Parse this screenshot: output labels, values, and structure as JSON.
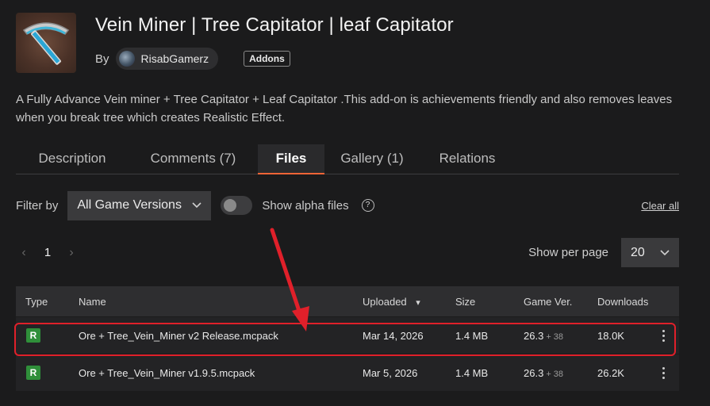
{
  "header": {
    "title": "Vein Miner | Tree Capitator | leaf Capitator",
    "by_label": "By",
    "author": "RisabGamerz",
    "category_badge": "Addons",
    "logo_icon": "pickaxe-icon"
  },
  "summary": "A Fully Advance Vein miner + Tree Capitator + Leaf Capitator .This add-on is achievements friendly and also removes leaves when you break tree which creates Realistic Effect.",
  "tabs": [
    {
      "label": "Description"
    },
    {
      "label": "Comments (7)"
    },
    {
      "label": "Files",
      "active": true
    },
    {
      "label": "Gallery (1)"
    },
    {
      "label": "Relations"
    }
  ],
  "filters": {
    "filter_by_label": "Filter by",
    "game_version_selected": "All Game Versions",
    "show_alpha_label": "Show alpha files",
    "show_alpha_enabled": false,
    "help_glyph": "?",
    "clear_all_label": "Clear all"
  },
  "pagination": {
    "prev_glyph": "‹",
    "current_page": "1",
    "next_glyph": "›",
    "per_page_label": "Show per page",
    "per_page_value": "20"
  },
  "table": {
    "headers": {
      "type": "Type",
      "name": "Name",
      "uploaded": "Uploaded",
      "size": "Size",
      "game_ver": "Game Ver.",
      "downloads": "Downloads"
    },
    "sort_indicator": "▾",
    "rows": [
      {
        "type": "R",
        "name": "Ore + Tree_Vein_Miner v2 Release.mcpack",
        "uploaded": "Mar 14, 2026",
        "size": "1.4 MB",
        "game_ver": "26.3",
        "game_ver_extra": "+ 38",
        "downloads": "18.0K",
        "highlighted": true
      },
      {
        "type": "R",
        "name": "Ore + Tree_Vein_Miner v1.9.5.mcpack",
        "uploaded": "Mar 5, 2026",
        "size": "1.4 MB",
        "game_ver": "26.3",
        "game_ver_extra": "+ 38",
        "downloads": "26.2K"
      }
    ]
  },
  "colors": {
    "accent_tab_underline": "#f16436",
    "release_badge": "#2f8f3a",
    "annotation_red": "#e0202a"
  }
}
